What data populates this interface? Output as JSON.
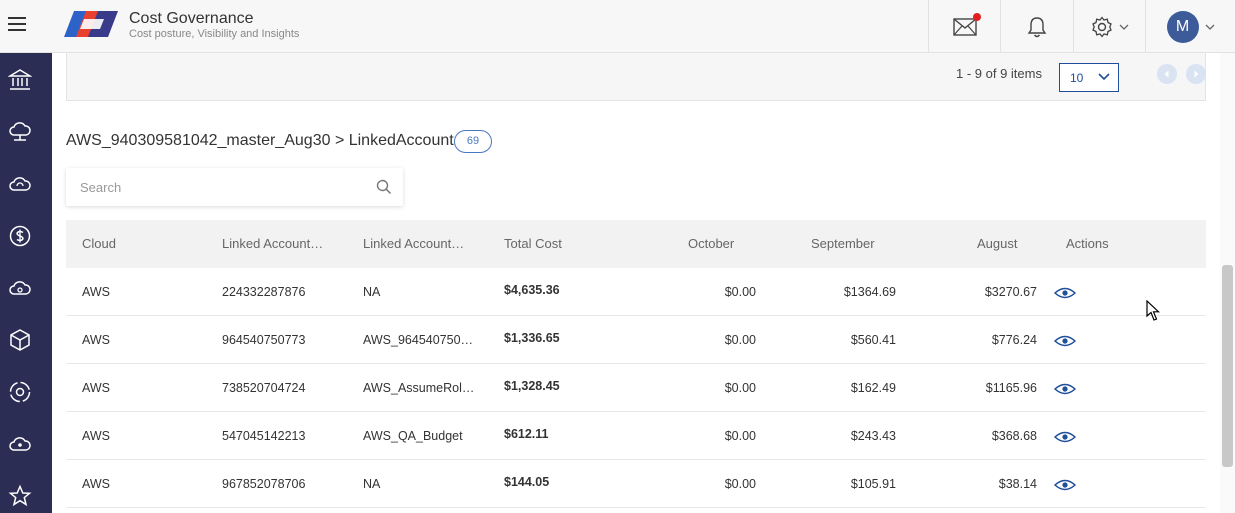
{
  "header": {
    "title": "Cost Governance",
    "subtitle": "Cost posture, Visibility and Insights",
    "avatar_initial": "M",
    "icons": [
      "menu-icon",
      "mail-icon",
      "bell-icon",
      "gear-icon",
      "chevron-down-icon"
    ]
  },
  "sidebar": {
    "icons": [
      "bank-icon",
      "cloud-network-icon",
      "cloud-sync-icon",
      "dollar-icon",
      "cloud-upload-icon",
      "cube-icon",
      "gear-cycle-icon",
      "cloud-people-icon",
      "star-icon"
    ]
  },
  "pagination": {
    "items_text": "1 - 9 of 9 items",
    "page_size": "10"
  },
  "breadcrumb": "AWS_940309581042_master_Aug30 > LinkedAccount",
  "count_badge": "69",
  "search": {
    "placeholder": "Search"
  },
  "table": {
    "columns": [
      "Cloud",
      "Linked Account…",
      "Linked Account…",
      "Total Cost",
      "October",
      "September",
      "August",
      "Actions"
    ],
    "rows": [
      {
        "cloud": "AWS",
        "account_id": "224332287876",
        "account_name": "NA",
        "total": "$4,635.36",
        "october": "$0.00",
        "september": "$1364.69",
        "august": "$3270.67"
      },
      {
        "cloud": "AWS",
        "account_id": "964540750773",
        "account_name": "AWS_964540750…",
        "total": "$1,336.65",
        "october": "$0.00",
        "september": "$560.41",
        "august": "$776.24"
      },
      {
        "cloud": "AWS",
        "account_id": "738520704724",
        "account_name": "AWS_AssumeRol…",
        "total": "$1,328.45",
        "october": "$0.00",
        "september": "$162.49",
        "august": "$1165.96"
      },
      {
        "cloud": "AWS",
        "account_id": "547045142213",
        "account_name": "AWS_QA_Budget",
        "total": "$612.11",
        "october": "$0.00",
        "september": "$243.43",
        "august": "$368.68"
      },
      {
        "cloud": "AWS",
        "account_id": "967852078706",
        "account_name": "NA",
        "total": "$144.05",
        "october": "$0.00",
        "september": "$105.91",
        "august": "$38.14"
      }
    ]
  },
  "colors": {
    "sidebar": "#2b2d55",
    "accent": "#1f4e9c",
    "notification": "#e02020"
  }
}
